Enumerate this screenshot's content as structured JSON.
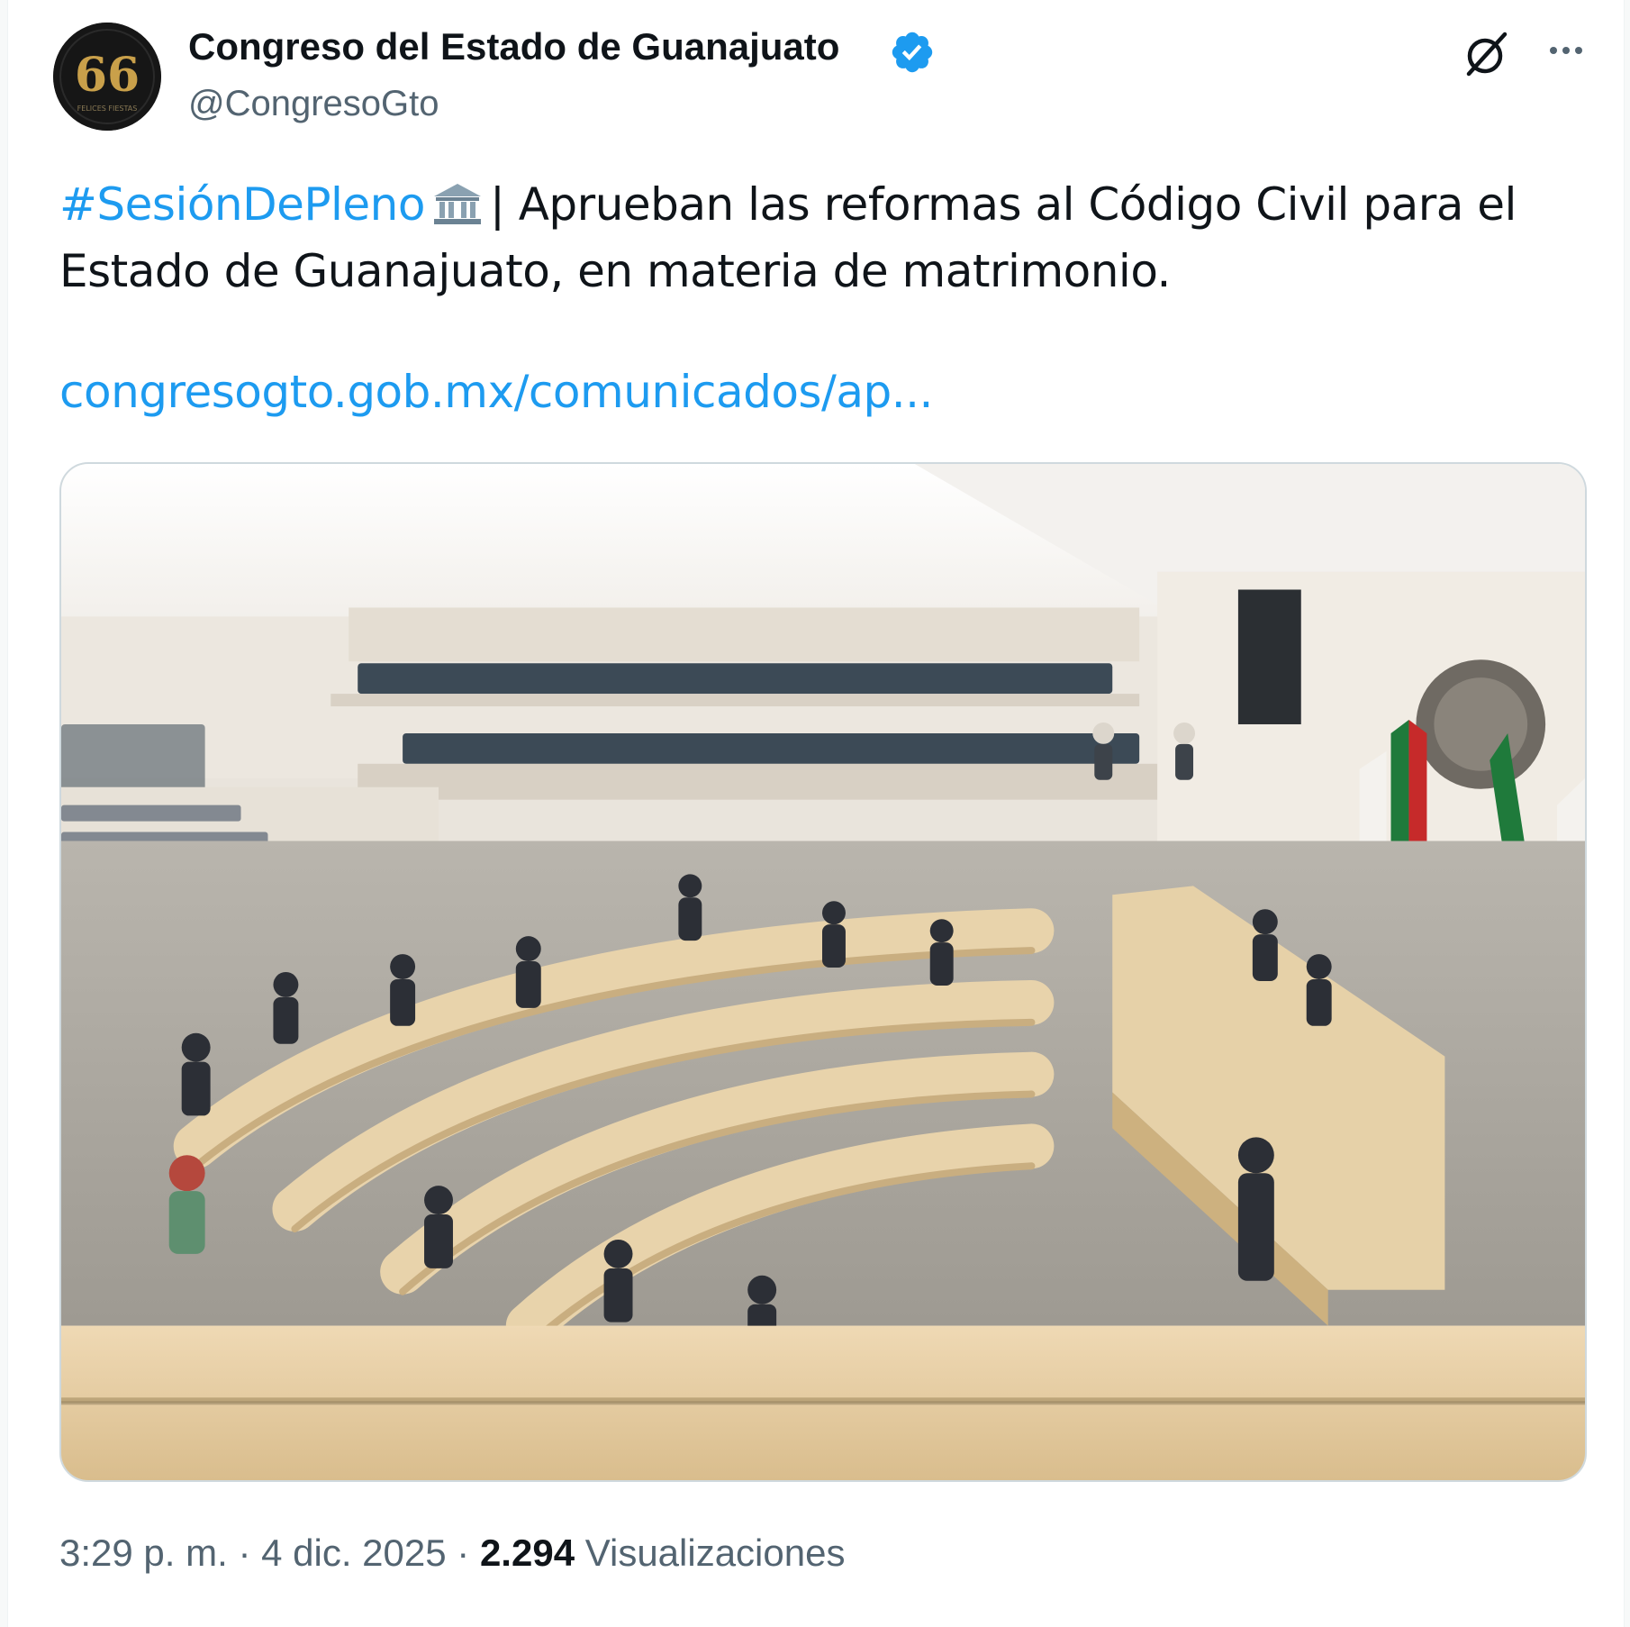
{
  "author": {
    "name": "Congreso del Estado de Guanajuato",
    "handle": "@CongresoGto",
    "avatar_icon": "congress-66-logo",
    "avatar_text": "FELICES FIESTAS",
    "verified": true,
    "verified_color": "#1d9bf0"
  },
  "actions": {
    "grok_icon": "grok-icon",
    "more_icon": "more-icon"
  },
  "tweet": {
    "hashtag": "#SesiónDePleno",
    "emoji_icon": "classical-building-icon",
    "body": "| Aprueban las reformas al Código Civil para el Estado de Guanajuato, en materia de matrimonio.",
    "link": "congresogto.gob.mx/comunicados/ap..."
  },
  "media": {
    "icon": "plenary-session-photo",
    "alt": "Sesión de pleno en el Congreso del Estado de Guanajuato"
  },
  "meta": {
    "time": "3:29 p. m.",
    "sep1": "·",
    "date": "4 dic. 2025",
    "sep2": "·",
    "views_count": "2.294",
    "views_label": "Visualizaciones"
  },
  "colors": {
    "link": "#1d9bf0",
    "text": "#0f1419",
    "secondary": "#536471"
  }
}
